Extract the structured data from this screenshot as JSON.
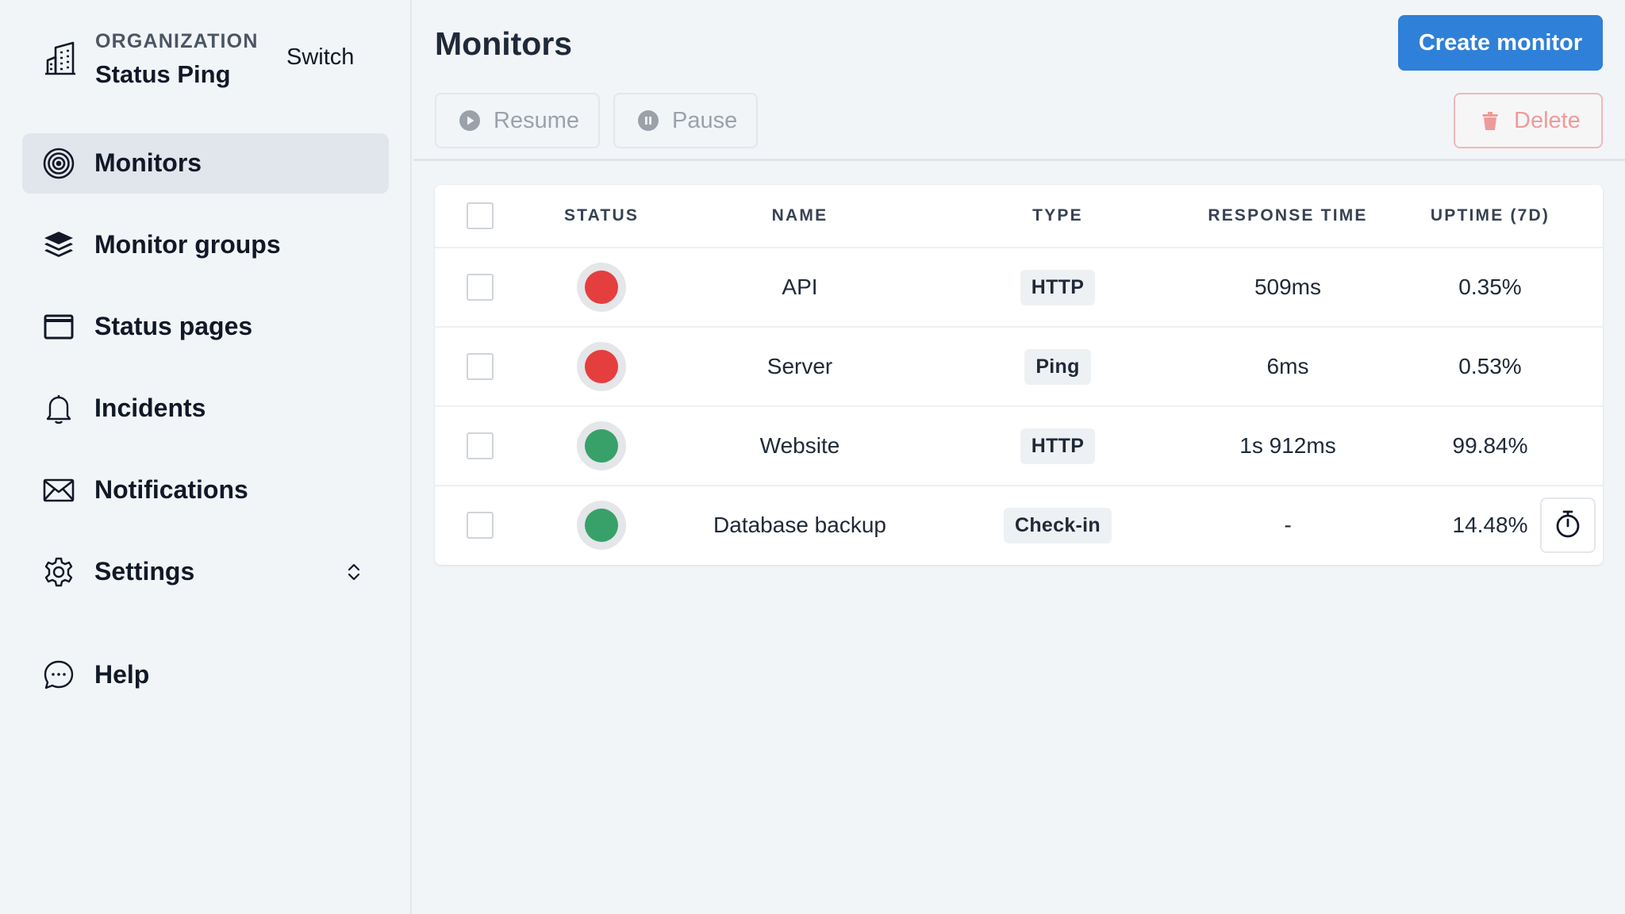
{
  "organization": {
    "label": "ORGANIZATION",
    "name": "Status Ping",
    "switch_label": "Switch",
    "icon": "building-icon"
  },
  "sidebar": {
    "items": [
      {
        "label": "Monitors",
        "icon": "target-icon",
        "active": true
      },
      {
        "label": "Monitor groups",
        "icon": "layers-icon",
        "active": false
      },
      {
        "label": "Status pages",
        "icon": "window-icon",
        "active": false
      },
      {
        "label": "Incidents",
        "icon": "bell-icon",
        "active": false
      },
      {
        "label": "Notifications",
        "icon": "envelope-icon",
        "active": false
      },
      {
        "label": "Settings",
        "icon": "gear-icon",
        "active": false,
        "expandable": true
      },
      {
        "label": "Help",
        "icon": "chat-bubble-icon",
        "active": false
      }
    ]
  },
  "main": {
    "title": "Monitors",
    "create_button": "Create monitor",
    "toolbar": {
      "resume": "Resume",
      "pause": "Pause",
      "delete": "Delete"
    }
  },
  "table": {
    "headers": {
      "status": "STATUS",
      "name": "NAME",
      "type": "TYPE",
      "response_time": "RESPONSE TIME",
      "uptime": "UPTIME (7D)"
    },
    "rows": [
      {
        "status": "down",
        "name": "API",
        "type": "HTTP",
        "response_time": "509ms",
        "uptime": "0.35%"
      },
      {
        "status": "down",
        "name": "Server",
        "type": "Ping",
        "response_time": "6ms",
        "uptime": "0.53%"
      },
      {
        "status": "up",
        "name": "Website",
        "type": "HTTP",
        "response_time": "1s 912ms",
        "uptime": "99.84%"
      },
      {
        "status": "up",
        "name": "Database backup",
        "type": "Check-in",
        "response_time": "-",
        "uptime": "14.48%",
        "action_icon": "stopwatch-icon"
      }
    ]
  },
  "colors": {
    "accent": "#2f80d8",
    "status_down": "#e53e3e",
    "status_up": "#38a169",
    "delete": "#ef9a9a",
    "active_nav_bg": "#e1e6ed"
  }
}
